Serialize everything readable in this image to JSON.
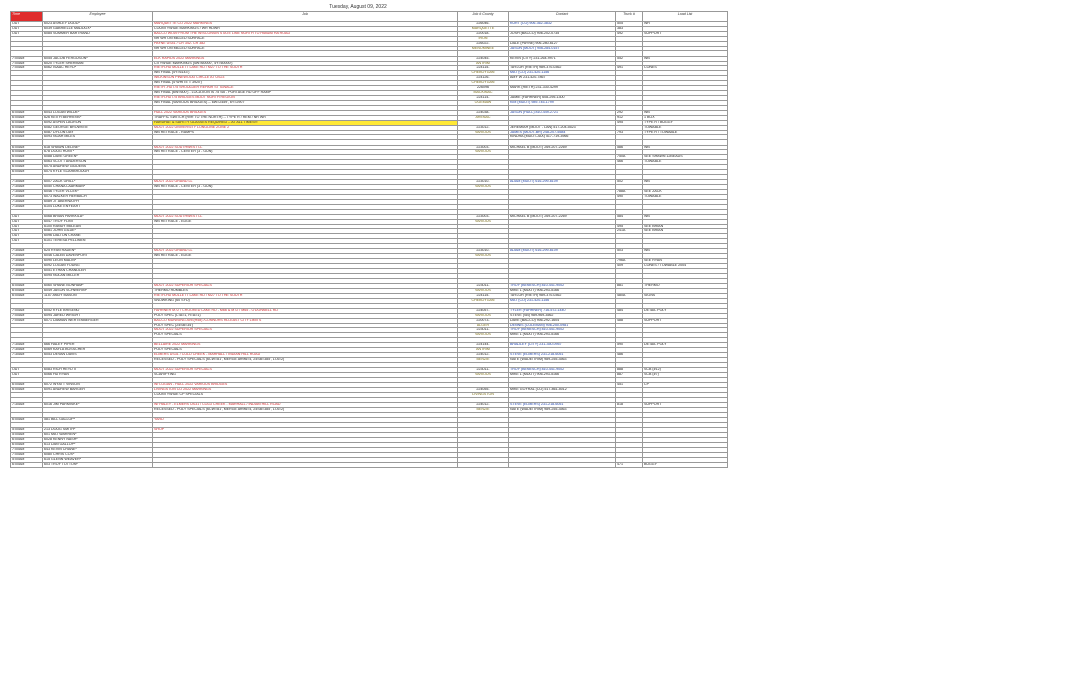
{
  "page": {
    "title": "Tuesday, August 09, 2022"
  },
  "headers": {
    "time": "Time",
    "employee": "Employee",
    "job": "Job",
    "job_num": "Job # County",
    "contact": "Contact",
    "truck": "Truck #",
    "load": "Load List"
  },
  "colors": {
    "header_red": "#e02c2c",
    "job_red": "#d0262b",
    "contact_blue": "#1b3fa8",
    "county_olive": "#7a6c17",
    "highlight": "#ffe936"
  },
  "rows": [
    {
      "t": "OUT",
      "e": "6023 ASHLEY DODD*",
      "j": "MARQUETTE CO 2022 MARKINGS",
      "jc": "red",
      "n": "226046-",
      "c": "KURT (CO) 906-362-3832",
      "cc": "blue",
      "k": "505",
      "l": "WR"
    },
    {
      "t": "OUT",
      "e": "6039 GABRIELLE MADDOX*",
      "j": "COUNTYWIDE MARKINGS / WR HDWR",
      "n": "MARQUETTE",
      "nc": "olive",
      "c": "",
      "k": "383",
      "l": ""
    },
    {
      "t": "OUT",
      "e": "6085 SUMMER BARTRAND",
      "j": "BACCO WI-69 FROM THE WISCONSIN STATE LINE NORTH TO HIAWATHA ROAD",
      "jc": "red",
      "n": "220018-",
      "c": "JOSH (BACCO) 906-202-0735",
      "k": "492",
      "l": "SUPPORT"
    },
    {
      "t": "",
      "e": "",
      "j": "NR WR ON MILLED SURFACE",
      "n": "IRON",
      "nc": "olive",
      "c": "",
      "k": "",
      "l": ""
    },
    {
      "t": "",
      "e": "",
      "j": "PAYNE US41 / CR 342- CR 382",
      "jc": "red",
      "n": "226022-",
      "c": "DALE (PAYNE) 906-280-6127",
      "k": "",
      "l": ""
    },
    {
      "t": "",
      "e": "",
      "j": "NR WR ON MILLED SURFACE",
      "n": "MENOMINEE",
      "nc": "olive",
      "c": "JASON (MDOT) 906-284-0157",
      "cc": "blue",
      "k": "",
      "l": ""
    },
    {
      "gap": true
    },
    {
      "t": "7:00AM",
      "e": "6055 JACOB FERGUSON*",
      "j": "ELK RAPIDS 2022 MARKINGS",
      "jc": "red",
      "n": "224045-",
      "c": "KEVIN (CITY) 231-264-9971",
      "k": "552",
      "l": "WB"
    },
    {
      "t": "7:00AM",
      "e": "6020 TYLER SHERMAN",
      "j": "CITYWIDE MARKINGS (4W=60000', 4Y=60000')",
      "n": "ANTRIM",
      "nc": "olive",
      "c": "",
      "k": "",
      "l": ""
    },
    {
      "t": "7:00AM",
      "e": "6062 ISAAC HEYD*",
      "j": "RIETH-HD MULLETT LAKE RD / M27 TO THE SOUTH",
      "jc": "red",
      "n": "224115-",
      "c": "TAYLOR (RIETH) 989-370-0362",
      "k": "491",
      "l": "CONES"
    },
    {
      "t": "",
      "e": "",
      "j": "WB FINAL (4Y=6143')",
      "n": "CHEBOYGAN",
      "nc": "olive",
      "c": "MAT (CO) 231-420-1156",
      "cc": "blue",
      "k": "",
      "l": ""
    },
    {
      "t": "",
      "e": "",
      "j": "WILKINSON PINEWOOD CIRCLE AT US23",
      "jc": "red",
      "n": "224126-",
      "c": "AMY W 231-420-7867",
      "k": "",
      "l": ""
    },
    {
      "t": "",
      "e": "",
      "j": "WB FINAL (4\"WHITE = 3920')",
      "n": "CHEBOYGAN",
      "nc": "olive",
      "c": "",
      "k": "",
      "l": ""
    },
    {
      "t": "",
      "e": "",
      "j": "RIETH -HD I75 SHOULDER REPAIR ST IGNACE",
      "jc": "red",
      "n": "226096",
      "c": "MARK (RIETH) 231-330-4299",
      "k": "",
      "l": ""
    },
    {
      "t": "",
      "e": "",
      "j": "WB FINAL (6W=600') - LOCATION IS 75 SB - PORTAGE RD OFF RAMP",
      "n": "MACKINAC",
      "nc": "olive",
      "c": "",
      "k": "",
      "l": ""
    },
    {
      "t": "",
      "e": "",
      "j": "RIETH-HD I75 BRIDGES MDOT NORTH REGION",
      "jc": "red",
      "n": "224114-",
      "c": "JAMIE (FAHRNER) 608-295-1300",
      "k": "",
      "l": ""
    },
    {
      "t": "",
      "e": "",
      "j": "WB FINAL (VARIOUS BRIDGES) -- 6W=2459', 6Y=2907'",
      "n": "OGEMAW",
      "nc": "olive",
      "c": "KIM (MDOT) 989-745-1799",
      "cc": "blue",
      "k": "",
      "l": ""
    },
    {
      "gap": true
    },
    {
      "t": "6:00AM",
      "e": "6043 LOGAN WILDE*",
      "j": "HULL 2022 VARIOUS BRIDGES",
      "jc": "red",
      "n": "224038-",
      "c": "JASON (HULL) 810-449-2721",
      "cc": "blue",
      "k": "292",
      "l": "WB"
    },
    {
      "t": "6:00AM",
      "e": "626 KEITH BEHRENS*",
      "j": "TRAFFIC SWITCH (RvR TO THE NORTH) -- TYPE R / REM / NR WR",
      "n": "ARENAC",
      "nc": "olive",
      "c": "",
      "k": "912",
      "l": "1 BOX"
    },
    {
      "t": "6:00AM",
      "e": "6092 ASPEN LAGRON",
      "j": "HARDHAT & SAFETY GLASSES REQUIRED -- AT ALL TIMES!!!",
      "jc": "hl",
      "n": "",
      "c": "",
      "k": "495",
      "l": "TYPE R / BUGGY"
    },
    {
      "t": "6:00AM",
      "e": "6082 GEORGE BROWN III",
      "j": "MDOT 2022 UNIVERSITY LONGLINE ZONE 2",
      "jc": "red",
      "n": "223012-",
      "c": "JEREMIAH (MDOT - LAN) 517-204-5523",
      "k": "",
      "l": "TOWABLE"
    },
    {
      "t": "6:00AM",
      "e": "6087 DYLON DAY",
      "j": "WB RETRACE - RAMPS",
      "n": "VARIOUS",
      "nc": "olive",
      "c": "JAMES (MDOT-BR) 248-207-5584",
      "cc": "blue",
      "k": "793",
      "l": "TYPE R / TOWABLE"
    },
    {
      "t": "6:00AM",
      "e": "6093 NOAH MILES",
      "j": "",
      "n": "",
      "c": "KINDRA (MDOT-JAX) 517-719-3966",
      "k": "",
      "l": ""
    },
    {
      "gap": true
    },
    {
      "t": "6:00AM",
      "e": "618 SHAWN DELINE*",
      "j": "MDOT 2022 SOUTHWEST LL",
      "jc": "red",
      "n": "223003-",
      "c": "MICHAEL B (MDOT) 269-207-2269",
      "k": "586",
      "l": "WB"
    },
    {
      "t": "6:00AM",
      "e": "678 DOUG HUNT*",
      "j": "WB RETRACE - CENTER (3 - GUN)",
      "n": "VARIOUS",
      "nc": "olive",
      "c": "",
      "k": "",
      "l": ""
    },
    {
      "t": "6:00AM",
      "e": "6088 DAVE GREEN*",
      "j": "",
      "n": "",
      "c": "",
      "k": "750A",
      "l": "SEE SHAWN 12BEADS"
    },
    {
      "t": "6:00AM",
      "e": "6063 SCOTT ANDERSON",
      "j": "",
      "n": "",
      "c": "",
      "k": "466",
      "l": "TOWABLE"
    },
    {
      "t": "6:00AM",
      "e": "6075 ANDREW GIDDENS",
      "j": "",
      "n": "",
      "c": "",
      "k": "",
      "l": ""
    },
    {
      "t": "6:00AM",
      "e": "6074 KYLE SCARBROUGH",
      "j": "",
      "n": "",
      "c": "",
      "k": "",
      "l": ""
    },
    {
      "gap": true
    },
    {
      "t": "7:30AM",
      "e": "6007 ZACK GRILL*",
      "j": "MDOT 2022 GRAND LL",
      "jc": "red",
      "n": "223010-",
      "c": "ADAM (MDOT) 616-299-8109",
      "cc": "blue",
      "k": "502",
      "l": "WB"
    },
    {
      "t": "7:30AM",
      "e": "6050 CHANA LAARMAN*",
      "j": "WB RETRACE - CENTER (3 - GUN)",
      "n": "VARIOUS",
      "nc": "olive",
      "c": "",
      "k": "",
      "l": ""
    },
    {
      "t": "7:30AM",
      "e": "6046 TYLER VLCEK*",
      "j": "",
      "n": "",
      "c": "",
      "k": "788A",
      "l": "SEE ZACK"
    },
    {
      "t": "7:30AM",
      "e": "6073 WALKER HERBACH",
      "j": "",
      "n": "",
      "c": "",
      "k": "490",
      "l": "TOWABLE"
    },
    {
      "t": "7:30AM",
      "e": "6089 JT ABERNATHY",
      "j": "",
      "n": "",
      "c": "",
      "k": "",
      "l": ""
    },
    {
      "t": "7:30AM",
      "e": "6104 LUKE ENYEART",
      "j": "",
      "n": "",
      "c": "",
      "k": "",
      "l": ""
    },
    {
      "gap": true
    },
    {
      "t": "OUT",
      "e": "6068 BRIAN PARKKILA*",
      "j": "MDOT 2022 SOUTHWEST LL",
      "jc": "red",
      "n": "223003-",
      "c": "MICHAEL B (MDOT) 269-207-2269",
      "k": "584",
      "l": "WB"
    },
    {
      "t": "OUT",
      "e": "6047 TROY FLINT",
      "j": "WB RETRACE - EDGE",
      "n": "VARIOUS",
      "nc": "olive",
      "c": "",
      "k": "",
      "l": ""
    },
    {
      "t": "OUT",
      "e": "6100 RANDY McLEAN",
      "j": "",
      "n": "",
      "c": "",
      "k": "495",
      "l": "SEE BRIAN"
    },
    {
      "t": "OUT",
      "e": "6081 JOHN GILDE*",
      "j": "",
      "n": "",
      "c": "",
      "k": "241A",
      "l": "SEE BRIAN"
    },
    {
      "t": "OUT",
      "e": "6096 DALTON CRANE",
      "j": "",
      "n": "",
      "c": "",
      "k": "",
      "l": ""
    },
    {
      "t": "OUT",
      "e": "6101 TERESA PELLINEN",
      "j": "",
      "n": "",
      "c": "",
      "k": "",
      "l": ""
    },
    {
      "gap": true
    },
    {
      "t": "7:30AM",
      "e": "625 RYAN RADEN*",
      "j": "MDOT 2022 GRAND LL",
      "jc": "red",
      "n": "223010-",
      "c": "ADAM (MDOT) 616-299-8109",
      "cc": "blue",
      "k": "503",
      "l": "WB"
    },
    {
      "t": "7:30AM",
      "e": "6046 CALEB DAVENPORT",
      "j": "WB RETRACE - EDGE",
      "n": "VARIOUS",
      "nc": "olive",
      "c": "",
      "k": "",
      "l": ""
    },
    {
      "t": "7:30AM",
      "e": "6090 LEON MALIN*",
      "j": "",
      "n": "",
      "c": "",
      "k": "796A",
      "l": "SEE RYAN"
    },
    {
      "t": "7:30AM",
      "e": "6092 LOGAN YOUNG",
      "j": "",
      "n": "",
      "c": "",
      "k": "409",
      "l": "CONES / TOWABLE 2004"
    },
    {
      "t": "7:30AM",
      "e": "6051 ETHAN CHANDLER",
      "j": "",
      "n": "",
      "c": "",
      "k": "",
      "l": ""
    },
    {
      "t": "7:30AM",
      "e": "6095 NOLAN MILLER",
      "j": "",
      "n": "",
      "c": "",
      "k": "",
      "l": ""
    },
    {
      "gap": true
    },
    {
      "t": "6:00AM",
      "e": "6060 SHANE BONHAM*",
      "j": "MDOT 2022 SUPERIOR SPECIALS",
      "jc": "red",
      "n": "223011-",
      "c": "TROY (BENESCH) 810-441-9002",
      "cc": "blue",
      "k": "881",
      "l": "THERMO"
    },
    {
      "t": "6:00AM",
      "e": "6049 JASON SCHWERIN*",
      "j": "THERMO RUMBLES",
      "n": "VARIOUS",
      "nc": "olive",
      "c": "MIKE L (MDOT) 906-293-5166",
      "k": "",
      "l": ""
    },
    {
      "t": "6:00AM",
      "e": "1157 ANDY MASON",
      "j": "RIETH-HD MULLETT LAKE RD / M27 TO THE SOUTH",
      "jc": "red",
      "n": "224115-",
      "c": "TAYLOR (RIETH) 989-370-0362",
      "k": "480A",
      "l": "SIGNS"
    },
    {
      "t": "",
      "e": "",
      "j": "SNOWKING (60 SYD)",
      "n": "CHEBOYGAN",
      "nc": "olive",
      "c": "MAT (CO) 231-420-1156",
      "cc": "blue",
      "k": "",
      "l": ""
    },
    {
      "gap": true
    },
    {
      "t": "7:00AM",
      "e": "6052 KYLE BRISENO",
      "j": "FAHRNER M72 / CROOKED LAKE RD - M66 & M72 / M65 - O'DONNELL RD",
      "jc": "red",
      "n": "224057-",
      "c": "TYLER (FAHRNER) 716-572-1440",
      "cc": "blue",
      "k": "484",
      "l": "DETAIL POLY"
    },
    {
      "t": "7:00AM",
      "e": "6094 JARED WRIGHT",
      "j": "POLY SPEC (LTA=1, RTA=1)",
      "n": "VARIOUS",
      "nc": "olive",
      "c": "STEVE (SB) 989-969-3562",
      "k": "",
      "l": ""
    },
    {
      "t": "7:00AM",
      "e": "6071 DAMIAN WERTENBERGER",
      "j": "BACCO MUNISING AVE(H58) /CONNORS RD-EAST CITY LIMITS",
      "jc": "red",
      "n": "220073-",
      "c": "DAVE (BACCO) 906-292-1604",
      "k": "488",
      "l": "SUPPORT"
    },
    {
      "t": "",
      "e": "",
      "j": "POLY SPEC (24SB=34')",
      "n": "ALGER",
      "nc": "olive",
      "c": "DENNIS (COLEMAN) 906-250-0981",
      "cc": "blue",
      "k": "",
      "l": ""
    },
    {
      "t": "",
      "e": "",
      "j": "MDOT 2022 SUPERIOR SPECIALS",
      "jc": "red",
      "n": "223011-",
      "c": "TROY (BENESCH) 810-441-9002",
      "cc": "blue",
      "k": "",
      "l": ""
    },
    {
      "t": "",
      "e": "",
      "j": "POLY SPECIALS",
      "n": "VARIOUS",
      "nc": "olive",
      "c": "MIKE L (MDOT) 906-293-5166",
      "k": "",
      "l": ""
    },
    {
      "gap": true
    },
    {
      "t": "7:30AM",
      "e": "666 HALEY PIPER",
      "j": "BELLAIRE 2022 MARKINGS",
      "jc": "red",
      "n": "224144-",
      "c": "BRADLEY (CITY) 231-350-0957",
      "cc": "blue",
      "k": "590",
      "l": "DETAIL POLY"
    },
    {
      "t": "7:30AM",
      "e": "6069 KAYLA BOSSCHER",
      "j": "POLY SPECIALS",
      "n": "ANTRIM",
      "nc": "olive",
      "c": "",
      "k": "",
      "l": ""
    },
    {
      "t": "7:30AM",
      "e": "6053 DEVAN DAVIS",
      "j": "ELMERS US31 / COLD CREEK - MARHALL / INDIAN HILL ROAD",
      "jc": "red",
      "n": "224012-",
      "c": "STEVE (ELMERS) 231-218-6051",
      "cc": "blue",
      "k": "486",
      "l": ""
    },
    {
      "t": "",
      "e": "",
      "j": "RECESSED - POLY SPECIALS (6CW=81', MERGE Arrow=4, 24SB=385', LTA=2)",
      "n": "BENZIE",
      "nc": "olive",
      "c": "NATE (WADE/TRIM) 989-255-3563",
      "k": "",
      "l": ""
    },
    {
      "gap": true
    },
    {
      "t": "OUT",
      "e": "6083 RICH HEYD II",
      "j": "MDOT 2022 SUPERIOR SPECIALS",
      "jc": "red",
      "n": "223011-",
      "c": "TROY (BENESCH) 810-441-9002",
      "cc": "blue",
      "k": "888",
      "l": "SCB (#12)"
    },
    {
      "t": "OUT",
      "e": "6066 HD RYAN",
      "j": "SCARIFYING",
      "n": "VARIOUS",
      "nc": "olive",
      "c": "MIKE L (MDOT) 906-293-5166",
      "k": "887",
      "l": "SCB (#7)"
    },
    {
      "gap": true
    },
    {
      "t": "6:00AM",
      "e": "6072 WYATT VINSON",
      "j": "W/ LOGAN - HULL 2022 VARIOUS BRIDGES",
      "jc": "red",
      "n": "",
      "c": "",
      "k": "451",
      "l": "CP"
    },
    {
      "t": "6:00AM",
      "e": "6091 ANDREW BARGER",
      "j": "LIVINGSTON CO 2022 MARKINGS",
      "jc": "red",
      "n": "224055-",
      "c": "MIKE GOYRAL (CO) 517-861-5012",
      "k": "",
      "l": ""
    },
    {
      "t": "",
      "e": "",
      "j": "COUNTYWIDE CP SPECIALS",
      "n": "LIVINGSTON",
      "nc": "olive",
      "c": "",
      "k": "",
      "l": ""
    },
    {
      "gap": true
    },
    {
      "t": "7:30AM",
      "e": "6016 JIM PARMISKE*",
      "j": "W/ HALEY - ELMERS US31 / COLD CREEK - MARHALL / INDIAN HILL ROAD",
      "jc": "red",
      "n": "224012-",
      "c": "STEVE (ELMERS) 231-218-6051",
      "cc": "blue",
      "k": "818",
      "l": "SUPPORT"
    },
    {
      "t": "",
      "e": "",
      "j": "RECESSED - POLY SPECIALS (6CW=81', MERGE Arrow=4, 24SB=385', LTA=2)",
      "n": "BENZIE",
      "nc": "olive",
      "c": "NATE (WADE/TRIM) 989-255-3563",
      "k": "",
      "l": ""
    },
    {
      "gap": true
    },
    {
      "t": "6:00AM",
      "e": "581 BILL GALLOP*",
      "j": "YARD",
      "jc": "red",
      "n": "",
      "c": "",
      "k": "",
      "l": ""
    },
    {
      "gap": true
    },
    {
      "t": "5:00AM",
      "e": "213 DOUG SMITH*",
      "j": "SHOP",
      "jc": "red",
      "n": "",
      "c": "",
      "k": "",
      "l": ""
    },
    {
      "t": "5:00AM",
      "e": "601 MAT WARREN*",
      "j": "",
      "n": "",
      "c": "",
      "k": "",
      "l": ""
    },
    {
      "t": "6:00AM",
      "e": "6028 KENNY NASH*",
      "j": "",
      "n": "",
      "c": "",
      "k": "",
      "l": ""
    },
    {
      "t": "6:00AM",
      "e": "613 DAN GALLOP*",
      "j": "",
      "n": "",
      "c": "",
      "k": "",
      "l": ""
    },
    {
      "t": "7:00AM",
      "e": "643 KEVIN CRANE*",
      "j": "",
      "n": "",
      "c": "",
      "k": "",
      "l": ""
    },
    {
      "t": "7:00AM",
      "e": "6080 CHRIS COX*",
      "j": "",
      "n": "",
      "c": "",
      "k": "",
      "l": ""
    },
    {
      "t": "5:00AM",
      "e": "615 GLENN WEAVER*",
      "j": "",
      "n": "",
      "c": "",
      "k": "",
      "l": ""
    },
    {
      "t": "6:00AM",
      "e": "603 TROY TOTTON*",
      "j": "",
      "n": "",
      "c": "",
      "k": "471",
      "l": "BUGGY"
    }
  ]
}
